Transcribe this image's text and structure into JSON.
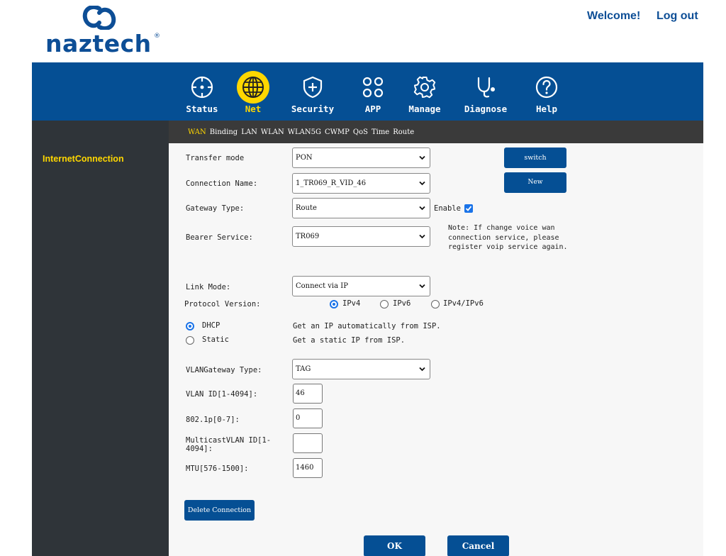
{
  "header": {
    "brand": "naztech",
    "brand_mark": "®",
    "welcome": "Welcome!",
    "logout": "Log out"
  },
  "nav": {
    "items": [
      {
        "label": "Status",
        "icon": "crosshair-icon"
      },
      {
        "label": "Net",
        "icon": "globe-icon",
        "active": true
      },
      {
        "label": "Security",
        "icon": "shield-plus-icon"
      },
      {
        "label": "APP",
        "icon": "apps-grid-icon"
      },
      {
        "label": "Manage",
        "icon": "gear-icon"
      },
      {
        "label": "Diagnose",
        "icon": "stethoscope-icon"
      },
      {
        "label": "Help",
        "icon": "question-icon"
      }
    ]
  },
  "subnav": {
    "items": [
      "WAN",
      "Binding",
      "LAN",
      "WLAN",
      "WLAN5G",
      "CWMP",
      "QoS",
      "Time",
      "Route"
    ],
    "active": "WAN"
  },
  "sidebar": {
    "items": [
      "InternetConnection"
    ]
  },
  "form": {
    "transfer_mode": {
      "label": "Transfer mode",
      "value": "PON"
    },
    "switch_button": "switch",
    "connection_name": {
      "label": "Connection Name:",
      "value": "1_TR069_R_VID_46"
    },
    "new_button": "New",
    "gateway_type": {
      "label": "Gateway Type:",
      "value": "Route"
    },
    "enable": {
      "label": "Enable",
      "checked": true
    },
    "bearer_service": {
      "label": "Bearer Service:",
      "value": "TR069"
    },
    "note": "Note: If change voice wan connection service, please register voip service again.",
    "link_mode": {
      "label": "Link Mode:",
      "value": "Connect via IP"
    },
    "protocol_version": {
      "label": "Protocol Version:",
      "options": [
        "IPv4",
        "IPv6",
        "IPv4/IPv6"
      ],
      "selected": "IPv4"
    },
    "address_mode": {
      "options": [
        {
          "label": "DHCP",
          "desc": "Get an IP automatically from ISP.",
          "selected": true
        },
        {
          "label": "Static",
          "desc": "Get a static IP from ISP.",
          "selected": false
        }
      ]
    },
    "vlan_gateway_type": {
      "label": "VLANGateway Type:",
      "value": "TAG"
    },
    "vlan_id": {
      "label": "VLAN ID[1-4094]:",
      "value": "46"
    },
    "priority": {
      "label": "802.1p[0-7]:",
      "value": "0"
    },
    "multicast_vlan_id": {
      "label_line1": "MulticastVLAN ID[1-",
      "label_line2": "4094]:",
      "value": ""
    },
    "mtu": {
      "label": "MTU[576-1500]:",
      "value": "1460"
    },
    "delete_button": "Delete Connection",
    "ok_button": "OK",
    "cancel_button": "Cancel"
  },
  "colors": {
    "brand_blue": "#054f94",
    "accent_yellow": "#ffd700",
    "sidebar_dark": "#2f3439",
    "check_blue": "#1a73e8"
  }
}
